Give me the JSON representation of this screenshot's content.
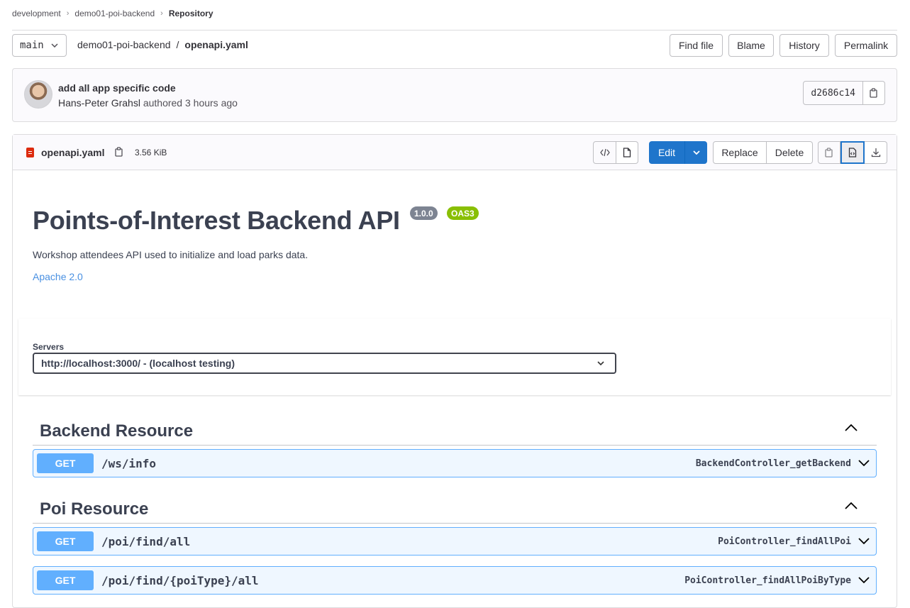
{
  "breadcrumb": [
    "development",
    "demo01-poi-backend",
    "Repository"
  ],
  "toolbar": {
    "branch": "main",
    "project": "demo01-poi-backend",
    "separator": "/",
    "file": "openapi.yaml",
    "find_file": "Find file",
    "blame": "Blame",
    "history": "History",
    "permalink": "Permalink"
  },
  "commit": {
    "title": "add all app specific code",
    "author": "Hans-Peter Grahsl",
    "meta": "authored 3 hours ago",
    "sha": "d2686c14"
  },
  "file_header": {
    "name": "openapi.yaml",
    "size": "3.56 KiB",
    "edit": "Edit",
    "replace": "Replace",
    "delete": "Delete"
  },
  "api": {
    "title": "Points-of-Interest Backend API",
    "version": "1.0.0",
    "oas": "OAS3",
    "description": "Workshop attendees API used to initialize and load parks data.",
    "license": "Apache 2.0"
  },
  "servers": {
    "label": "Servers",
    "selected": "http://localhost:3000/ - (localhost testing)"
  },
  "tags": [
    {
      "name": "Backend Resource",
      "operations": [
        {
          "method": "GET",
          "path": "/ws/info",
          "id": "BackendController_getBackend"
        }
      ]
    },
    {
      "name": "Poi Resource",
      "operations": [
        {
          "method": "GET",
          "path": "/poi/find/all",
          "id": "PoiController_findAllPoi"
        },
        {
          "method": "GET",
          "path": "/poi/find/{poiType}/all",
          "id": "PoiController_findAllPoiByType"
        }
      ]
    }
  ],
  "colors": {
    "accent": "#1f75cb",
    "get_method": "#61affe",
    "version_badge": "#7d8492",
    "oas_badge": "#89bf04",
    "file_icon": "#dd2b0e"
  }
}
